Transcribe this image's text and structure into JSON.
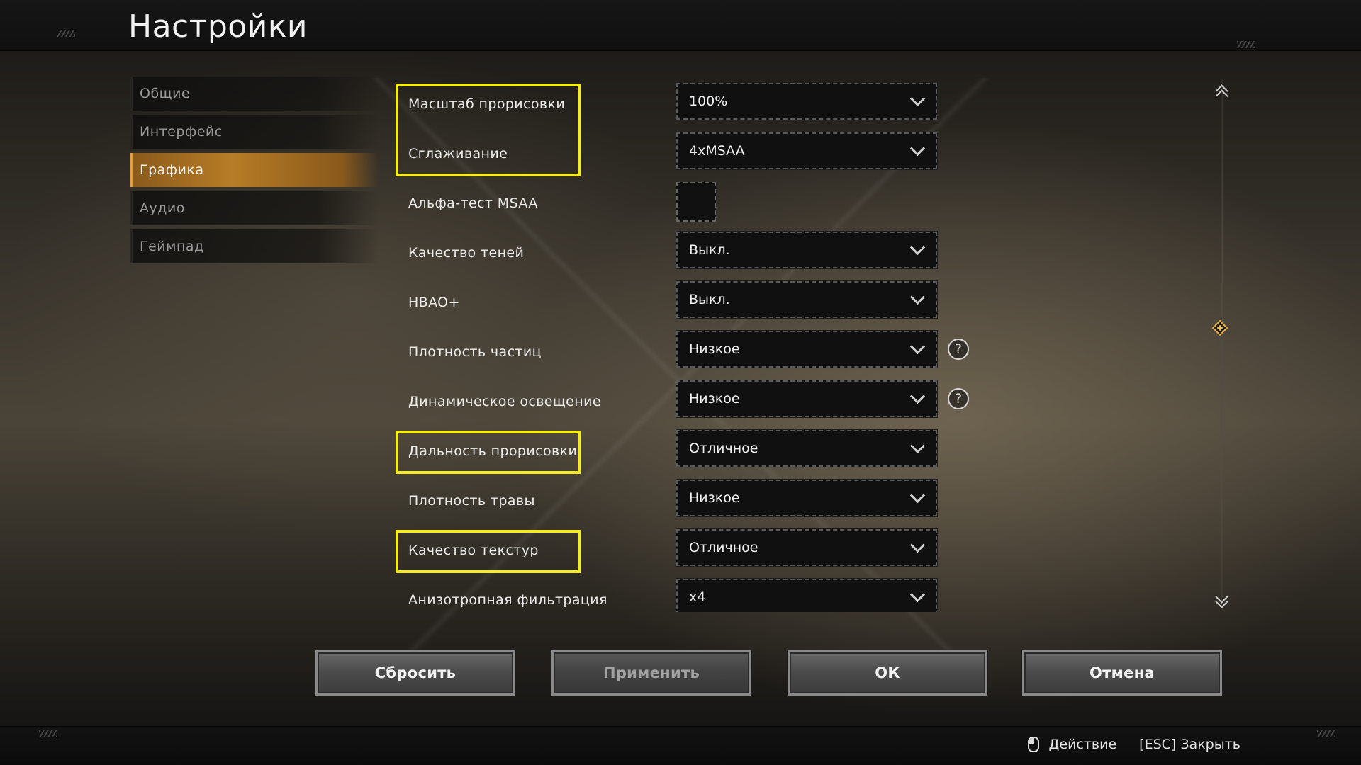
{
  "header": {
    "title": "Настройки"
  },
  "sidebar": {
    "items": [
      {
        "label": "Общие",
        "active": false
      },
      {
        "label": "Интерфейс",
        "active": false
      },
      {
        "label": "Графика",
        "active": true
      },
      {
        "label": "Аудио",
        "active": false
      },
      {
        "label": "Геймпад",
        "active": false
      }
    ]
  },
  "settings": {
    "rows": [
      {
        "label": "Масштаб прорисовки",
        "value": "100%"
      },
      {
        "label": "Сглаживание",
        "value": "4xMSAA"
      },
      {
        "label": "Альфа-тест MSAA",
        "checked": false
      },
      {
        "label": "Качество теней",
        "value": "Выкл."
      },
      {
        "label": "HBAO+",
        "value": "Выкл."
      },
      {
        "label": "Плотность частиц",
        "value": "Низкое",
        "help_icon": "question-mark"
      },
      {
        "label": "Динамическое освещение",
        "value": "Низкое",
        "help_icon": "question-mark"
      },
      {
        "label": "Дальность прорисовки",
        "value": "Отличное"
      },
      {
        "label": "Плотность травы",
        "value": "Низкое"
      },
      {
        "label": "Качество текстур",
        "value": "Отличное"
      },
      {
        "label": "Анизотропная фильтрация",
        "value": "x4"
      }
    ],
    "help_glyph": "?"
  },
  "buttons": {
    "reset_label": "Сбросить",
    "apply_label": "Применить",
    "ok_label": "ОК",
    "cancel_label": "Отмена"
  },
  "footer": {
    "action_hint": "Действие",
    "close_hint": "[ESC] Закрыть"
  },
  "colors": {
    "accent": "#b77c26",
    "highlight": "#f4ec20"
  }
}
